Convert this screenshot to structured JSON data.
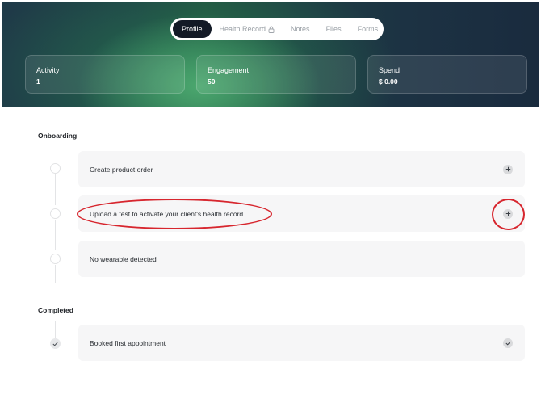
{
  "tabs": [
    {
      "label": "Profile",
      "active": true
    },
    {
      "label": "Health Record",
      "locked": true
    },
    {
      "label": "Notes"
    },
    {
      "label": "Files"
    },
    {
      "label": "Forms"
    }
  ],
  "stats": [
    {
      "title": "Activity",
      "value": "1"
    },
    {
      "title": "Engagement",
      "value": "50"
    },
    {
      "title": "Spend",
      "value": "$ 0.00"
    }
  ],
  "onboarding": {
    "title": "Onboarding",
    "items": [
      {
        "label": "Create product order",
        "action_icon": "plus-icon"
      },
      {
        "label": "Upload a test to activate your client's health record",
        "action_icon": "plus-icon"
      },
      {
        "label": "No wearable detected"
      }
    ]
  },
  "completed": {
    "title": "Completed",
    "items": [
      {
        "label": "Booked first appointment",
        "action_icon": "check-icon"
      }
    ]
  },
  "colors": {
    "annotation": "#d7262e",
    "active_tab_bg": "#131a26",
    "hero_accent": "#3f9c67"
  }
}
